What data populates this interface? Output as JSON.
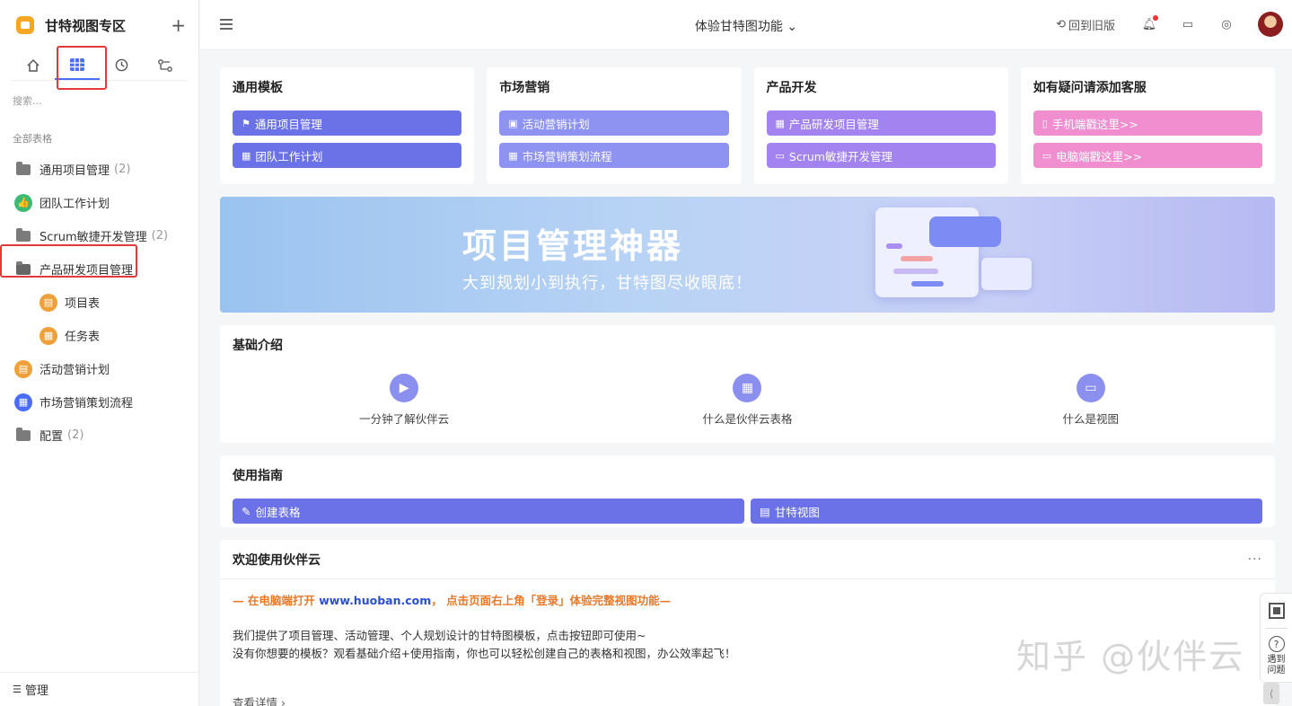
{
  "sidebar": {
    "title": "甘特视图专区",
    "plus": "+",
    "search_placeholder": "搜索...",
    "group_label": "全部表格",
    "items": [
      {
        "label": "通用项目管理",
        "count": "(2)"
      },
      {
        "label": "团队工作计划",
        "count": ""
      },
      {
        "label": "Scrum敏捷开发管理",
        "count": "(2)"
      },
      {
        "label": "产品研发项目管理",
        "count": ""
      },
      {
        "label": "项目表",
        "count": ""
      },
      {
        "label": "任务表",
        "count": ""
      },
      {
        "label": "活动营销计划",
        "count": ""
      },
      {
        "label": "市场营销策划流程",
        "count": ""
      },
      {
        "label": "配置",
        "count": "(2)"
      }
    ],
    "footer": "管理"
  },
  "topbar": {
    "title": "体验甘特图功能 ⌄",
    "back_old": "回到旧版"
  },
  "cards": [
    {
      "title": "通用模板",
      "buttons": [
        "通用项目管理",
        "团队工作计划"
      ]
    },
    {
      "title": "市场营销",
      "buttons": [
        "活动营销计划",
        "市场营销策划流程"
      ]
    },
    {
      "title": "产品开发",
      "buttons": [
        "产品研发项目管理",
        "Scrum敏捷开发管理"
      ]
    },
    {
      "title": "如有疑问请添加客服",
      "buttons": [
        "手机端戳这里>>",
        "电脑端戳这里>>"
      ]
    }
  ],
  "banner": {
    "title": "项目管理神器",
    "subtitle": "大到规划小到执行，甘特图尽收眼底！"
  },
  "intro": {
    "title": "基础介绍",
    "items": [
      "一分钟了解伙伴云",
      "什么是伙伴云表格",
      "什么是视图"
    ]
  },
  "guide": {
    "title": "使用指南",
    "buttons": [
      "创建表格",
      "甘特视图"
    ]
  },
  "welcome": {
    "title": "欢迎使用伙伴云",
    "more": "···",
    "line1_pre": "— 在电脑端打开 ",
    "line1_url": "www.huoban.com",
    "line1_post": "， 点击页面右上角「登录」体验完整视图功能—",
    "line2": "我们提供了项目管理、活动管理、个人规划设计的甘特图模板，点击按钮即可使用~",
    "line3": "没有你想要的模板？观看基础介绍+使用指南，你也可以轻松创建自己的表格和视图，办公效率起飞！",
    "detail": "查看详情 ›"
  },
  "watermark": "知乎 @伙伴云",
  "float": {
    "help": "遇到问题"
  },
  "colors": {
    "primary": "#6b72e8",
    "purple_light": "#8e92f0",
    "violet": "#a283f0",
    "pink": "#f08ed0",
    "orange": "#e8782a",
    "highlight_box": "#e03a3a"
  }
}
